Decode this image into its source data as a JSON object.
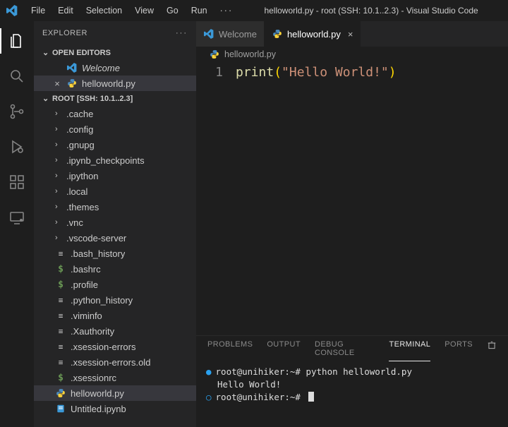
{
  "window_title": "helloworld.py - root (SSH: 10.1..2.3) - Visual Studio Code",
  "menu": [
    "File",
    "Edit",
    "Selection",
    "View",
    "Go",
    "Run"
  ],
  "explorer": {
    "title": "EXPLORER",
    "open_editors_label": "OPEN EDITORS",
    "open_editors": [
      {
        "label": "Welcome",
        "italic": true,
        "icon": "vscode"
      },
      {
        "label": "helloworld.py",
        "italic": false,
        "icon": "python",
        "close": true,
        "active": true
      }
    ],
    "root_label": "ROOT [SSH: 10.1..2.3]",
    "files": [
      {
        "label": ".cache",
        "kind": "folder"
      },
      {
        "label": ".config",
        "kind": "folder"
      },
      {
        "label": ".gnupg",
        "kind": "folder"
      },
      {
        "label": ".ipynb_checkpoints",
        "kind": "folder"
      },
      {
        "label": ".ipython",
        "kind": "folder"
      },
      {
        "label": ".local",
        "kind": "folder"
      },
      {
        "label": ".themes",
        "kind": "folder"
      },
      {
        "label": ".vnc",
        "kind": "folder"
      },
      {
        "label": ".vscode-server",
        "kind": "folder"
      },
      {
        "label": ".bash_history",
        "kind": "text"
      },
      {
        "label": ".bashrc",
        "kind": "shell"
      },
      {
        "label": ".profile",
        "kind": "shell"
      },
      {
        "label": ".python_history",
        "kind": "text"
      },
      {
        "label": ".viminfo",
        "kind": "text"
      },
      {
        "label": ".Xauthority",
        "kind": "text"
      },
      {
        "label": ".xsession-errors",
        "kind": "text"
      },
      {
        "label": ".xsession-errors.old",
        "kind": "text"
      },
      {
        "label": ".xsessionrc",
        "kind": "shell"
      },
      {
        "label": "helloworld.py",
        "kind": "python",
        "active": true
      },
      {
        "label": "Untitled.ipynb",
        "kind": "notebook"
      }
    ]
  },
  "tabs": [
    {
      "label": "Welcome",
      "icon": "vscode"
    },
    {
      "label": "helloworld.py",
      "icon": "python",
      "active": true,
      "closable": true
    }
  ],
  "breadcrumb": {
    "icon": "python",
    "label": "helloworld.py"
  },
  "code": {
    "line_number": "1",
    "fn": "print",
    "lparen": "(",
    "string": "\"Hello World!\"",
    "rparen": ")"
  },
  "panel": {
    "tabs": [
      "PROBLEMS",
      "OUTPUT",
      "DEBUG CONSOLE",
      "TERMINAL",
      "PORTS"
    ],
    "active_tab_index": 3,
    "terminal": {
      "line1_prompt": "root@unihiker:~# ",
      "line1_cmd": "python helloworld.py",
      "line2": "Hello World!",
      "line3": "root@unihiker:~# "
    }
  }
}
